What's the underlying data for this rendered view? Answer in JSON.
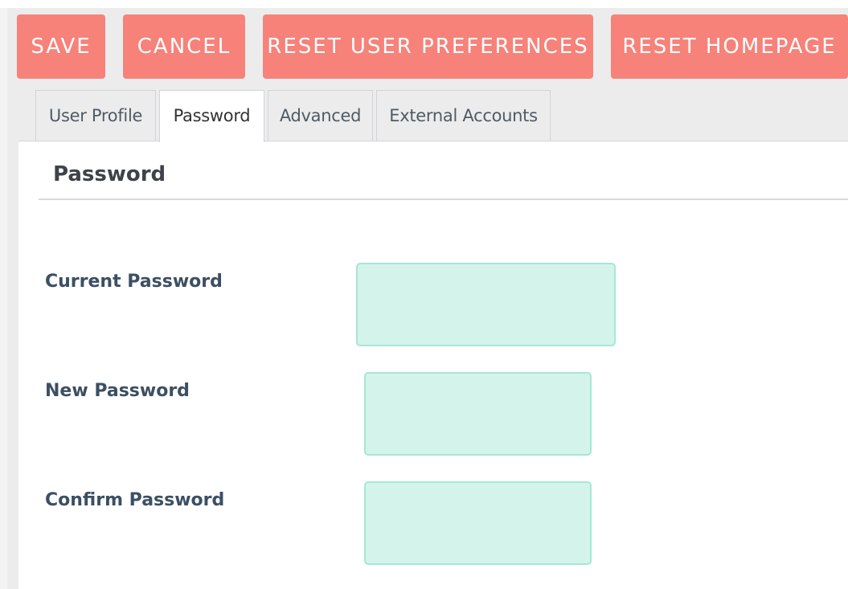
{
  "toolbar": {
    "save_label": "SAVE",
    "cancel_label": "CANCEL",
    "reset_prefs_label": "RESET USER PREFERENCES",
    "reset_home_label": "RESET HOMEPAGE"
  },
  "tabs": [
    {
      "label": "User Profile",
      "active": false
    },
    {
      "label": "Password",
      "active": true
    },
    {
      "label": "Advanced",
      "active": false
    },
    {
      "label": "External Accounts",
      "active": false
    }
  ],
  "section": {
    "title": "Password"
  },
  "fields": [
    {
      "label": "Current Password",
      "value": ""
    },
    {
      "label": "New Password",
      "value": ""
    },
    {
      "label": "Confirm Password",
      "value": ""
    }
  ],
  "colors": {
    "button": "#f6827a",
    "input_bg": "#d3f3eb",
    "input_border": "#a6e7d6"
  }
}
